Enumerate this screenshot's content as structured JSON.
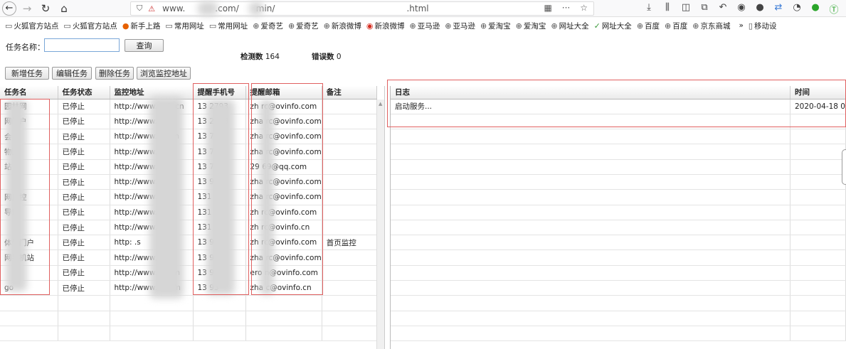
{
  "browser": {
    "url_prefix": "www.",
    "url_domain": ".com/",
    "url_path": "min/",
    "url_suffix": ".html",
    "more_label": "···",
    "star_label": "☆"
  },
  "bookmarks": [
    {
      "label": "火狐官方站点",
      "icon": "folder-icon"
    },
    {
      "label": "火狐官方站点",
      "icon": "folder-icon"
    },
    {
      "label": "新手上路",
      "icon": "firefox-icon"
    },
    {
      "label": "常用网址",
      "icon": "folder-icon"
    },
    {
      "label": "常用网址",
      "icon": "folder-icon"
    },
    {
      "label": "爱奇艺",
      "icon": "globe-icon"
    },
    {
      "label": "爱奇艺",
      "icon": "globe-icon"
    },
    {
      "label": "新浪微博",
      "icon": "globe-icon"
    },
    {
      "label": "新浪微博",
      "icon": "weibo-icon"
    },
    {
      "label": "亚马逊",
      "icon": "globe-icon"
    },
    {
      "label": "亚马逊",
      "icon": "globe-icon"
    },
    {
      "label": "爱淘宝",
      "icon": "globe-icon"
    },
    {
      "label": "爱淘宝",
      "icon": "globe-icon"
    },
    {
      "label": "网址大全",
      "icon": "globe-icon"
    },
    {
      "label": "网址大全",
      "icon": "hao-icon"
    },
    {
      "label": "百度",
      "icon": "globe-icon"
    },
    {
      "label": "百度",
      "icon": "globe-icon"
    },
    {
      "label": "京东商城",
      "icon": "globe-icon"
    },
    {
      "label": "»",
      "icon": ""
    },
    {
      "label": "移动设",
      "icon": "mobile-icon"
    }
  ],
  "search": {
    "label": "任务名称：",
    "value": "",
    "button": "查询"
  },
  "stats": {
    "detect_label": "检测数",
    "detect_value": "164",
    "error_label": "错误数",
    "error_value": "0"
  },
  "actions": {
    "add": "新增任务",
    "edit": "编辑任务",
    "delete": "删除任务",
    "browse": "浏览监控地址"
  },
  "task_table": {
    "headers": [
      "任务名",
      "任务状态",
      "监控地址",
      "提醒手机号",
      "提醒邮箱",
      "备注"
    ],
    "rows": [
      {
        "name": "园林网",
        "status": "已停止",
        "url": "http://www.g      sh.cn",
        "phone": "13      2793",
        "email": "zh      rc@ovinfo.com",
        "note": ""
      },
      {
        "name": "网门户",
        "status": "已停止",
        "url": "http://www.      cn",
        "phone": "13      2793",
        "email": "zha      rc@ovinfo.com",
        "note": ""
      },
      {
        "name": "会",
        "status": "已停止",
        "url": "http://www.s      g.cn",
        "phone": "13      793",
        "email": "zha      rc@ovinfo.com",
        "note": ""
      },
      {
        "name": "物园",
        "status": "已停止",
        "url": "http://www.      zoo.",
        "phone": "13      793",
        "email": "zha      rc@ovinfo.com",
        "note": ""
      },
      {
        "name": "站",
        "status": "已停止",
        "url": "http://www.      .cn",
        "phone": "13      793",
        "email": "29      69@qq.com",
        "note": ""
      },
      {
        "name": "",
        "status": "已停止",
        "url": "http://www.      .org",
        "phone": "13      93",
        "email": "zha      rc@ovinfo.com",
        "note": ""
      },
      {
        "name": "网监控",
        "status": "已停止",
        "url": "http://www.      n.cc",
        "phone": "131      93",
        "email": "zha      rc@ovinfo.com",
        "note": ""
      },
      {
        "name": "导站",
        "status": "已停止",
        "url": "http://www.l",
        "phone": "131      93",
        "email": "zh      rc@ovinfo.com",
        "note": ""
      },
      {
        "name": "",
        "status": "已停止",
        "url": "http://www.      ites/",
        "phone": "131      93",
        "email": "zh      rc@ovinfo.cn",
        "note": ""
      },
      {
        "name": "体化门户",
        "status": "已停止",
        "url": "http:      .s",
        "phone": "13      93",
        "email": "zh      rc@ovinfo.com",
        "note": "首页监控"
      },
      {
        "name": "网手机站",
        "status": "已停止",
        "url": "http://www.      n.cc",
        "phone": "13      93",
        "email": "zha      rc@ovinfo.com",
        "note": ""
      },
      {
        "name": "",
        "status": "已停止",
        "url": "http://www.ga      .cn",
        "phone": "13      96",
        "email": "ero      n@ovinfo.com",
        "note": ""
      },
      {
        "name": "go",
        "status": "已停止",
        "url": "http://www.ea      n/n",
        "phone": "13      93",
        "email": "zha      c@ovinfo.cn",
        "note": ""
      }
    ]
  },
  "log_table": {
    "headers": [
      "日志",
      "时间"
    ],
    "rows": [
      {
        "log": "启动服务...",
        "time": "2020-04-18 0"
      }
    ]
  },
  "colors": {
    "highlight": "#e06060",
    "accent_input_border": "#7aa7d8"
  }
}
